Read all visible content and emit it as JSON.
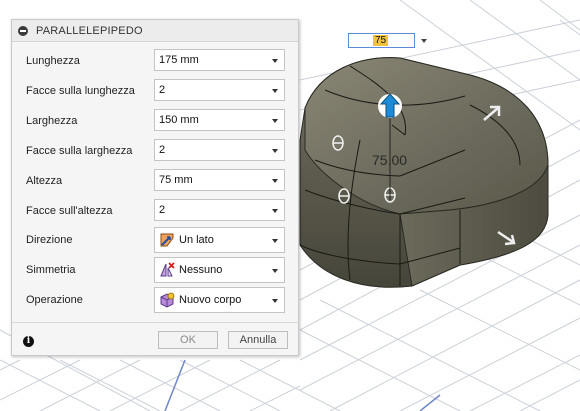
{
  "dialog": {
    "title": "PARALLELEPIPEDO",
    "fields": [
      {
        "label": "Lunghezza",
        "value": "175 mm"
      },
      {
        "label": "Facce sulla lunghezza",
        "value": "2"
      },
      {
        "label": "Larghezza",
        "value": "150 mm"
      },
      {
        "label": "Facce sulla larghezza",
        "value": "2"
      },
      {
        "label": "Altezza",
        "value": "75 mm"
      },
      {
        "label": "Facce sull'altezza",
        "value": "2"
      },
      {
        "label": "Direzione",
        "value": "Un lato",
        "icon": "one-side-direction-icon"
      },
      {
        "label": "Simmetria",
        "value": "Nessuno",
        "icon": "no-symmetry-icon"
      },
      {
        "label": "Operazione",
        "value": "Nuovo corpo",
        "icon": "new-body-icon"
      }
    ],
    "ok_label": "OK",
    "cancel_label": "Annulla"
  },
  "viewport": {
    "input_value": "75",
    "dimension_label": "75.00",
    "body_color": "#6e6c5f",
    "grid_color": "#c9cfd8",
    "arrow_color": "#1d8bd6"
  }
}
